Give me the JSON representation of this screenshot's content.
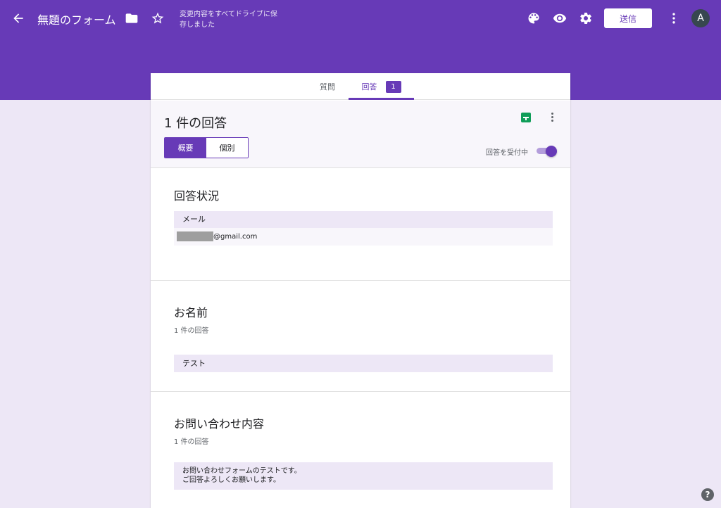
{
  "header": {
    "title": "無題のフォーム",
    "saved_status": "変更内容をすべてドライブに保存しました",
    "send_label": "送信",
    "avatar_initial": "A",
    "accent_color": "#673ab7",
    "icons": [
      "back-arrow-icon",
      "folder-icon",
      "star-icon",
      "palette-icon",
      "eye-icon",
      "gear-icon",
      "more-vert-icon"
    ]
  },
  "tabs": [
    {
      "label": "質問"
    },
    {
      "label": "回答",
      "badge": "1"
    }
  ],
  "summary": {
    "count_title": "1 件の回答",
    "view_tabs": [
      "概要",
      "個別"
    ],
    "accepting_label": "回答を受付中",
    "accepting_on": true
  },
  "sections": [
    {
      "title": "回答状況",
      "header_label": "メール",
      "email_suffix": "@gmail.com"
    },
    {
      "title": "お名前",
      "sub": "1 件の回答",
      "answer": "テスト"
    },
    {
      "title": "お問い合わせ内容",
      "sub": "1 件の回答",
      "answer_lines": [
        "お問い合わせフォームのテストです。",
        "ご回答よろしくお願いします。"
      ]
    }
  ],
  "help_icon": "?"
}
